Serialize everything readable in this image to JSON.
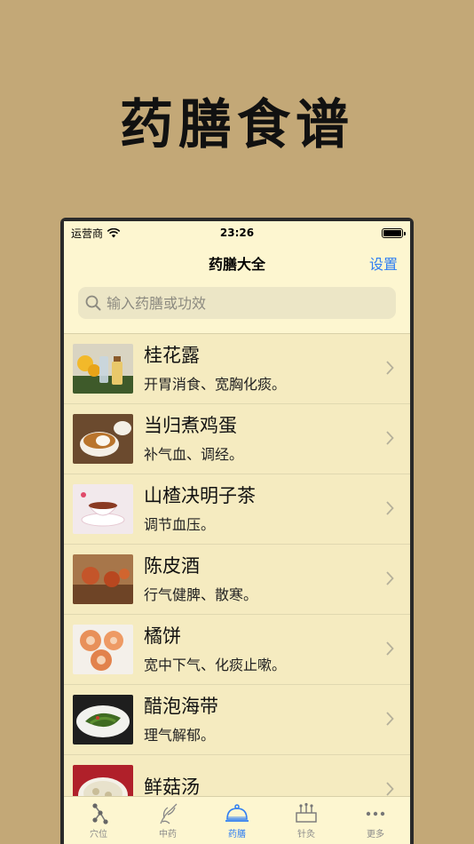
{
  "hero": {
    "title": "药膳食谱"
  },
  "status": {
    "carrier": "运营商",
    "time": "23:26"
  },
  "nav": {
    "title": "药膳大全",
    "settings_label": "设置"
  },
  "search": {
    "placeholder": "输入药膳或功效"
  },
  "items": [
    {
      "title": "桂花露",
      "subtitle": "开胃消食、宽胸化痰。"
    },
    {
      "title": "当归煮鸡蛋",
      "subtitle": "补气血、调经。"
    },
    {
      "title": "山楂决明子茶",
      "subtitle": "调节血压。"
    },
    {
      "title": "陈皮酒",
      "subtitle": "行气健脾、散寒。"
    },
    {
      "title": "橘饼",
      "subtitle": "宽中下气、化痰止嗽。"
    },
    {
      "title": "醋泡海带",
      "subtitle": "理气解郁。"
    },
    {
      "title": "鲜菇汤",
      "subtitle": ""
    }
  ],
  "tabs": [
    {
      "label": "穴位",
      "icon": "acupoint-icon",
      "active": false
    },
    {
      "label": "中药",
      "icon": "herb-icon",
      "active": false
    },
    {
      "label": "药膳",
      "icon": "food-cloche-icon",
      "active": true
    },
    {
      "label": "针灸",
      "icon": "acupuncture-icon",
      "active": false
    },
    {
      "label": "更多",
      "icon": "more-icon",
      "active": false
    }
  ],
  "colors": {
    "accent": "#2f7ef2",
    "background": "#c3a877",
    "screen": "#fdf6d0"
  }
}
